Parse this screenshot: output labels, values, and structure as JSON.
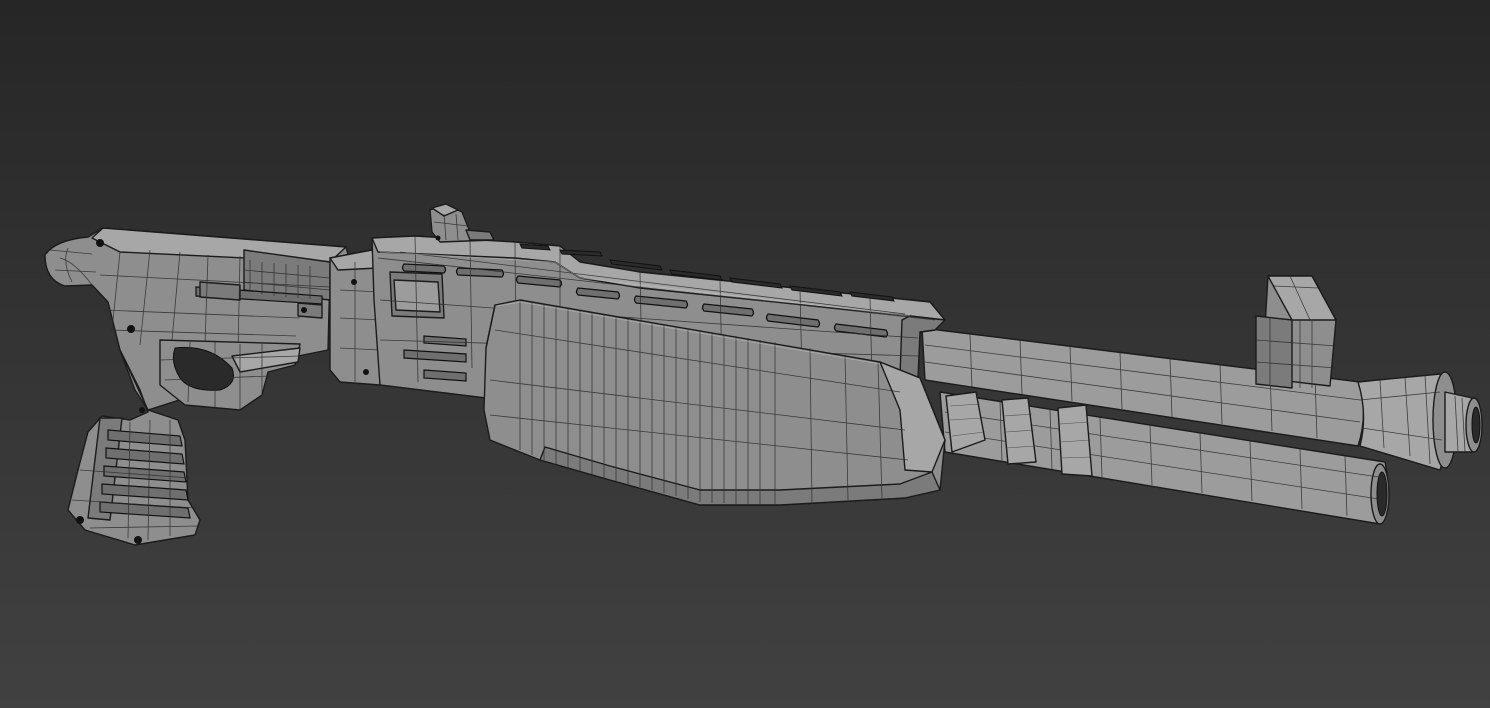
{
  "viewport": {
    "background_top": "#262626",
    "background_bottom": "#414141",
    "wire_color": "#1b1b1b",
    "material_color": "#8e8e8e"
  },
  "scene": {
    "object": "shotgun-wireframe-model",
    "parts": [
      "stock",
      "pistol-grip",
      "trigger-guard",
      "receiver",
      "rear-sight",
      "pump-forend",
      "barrel",
      "magazine-tube",
      "front-sight",
      "heat-shield-vents"
    ]
  }
}
